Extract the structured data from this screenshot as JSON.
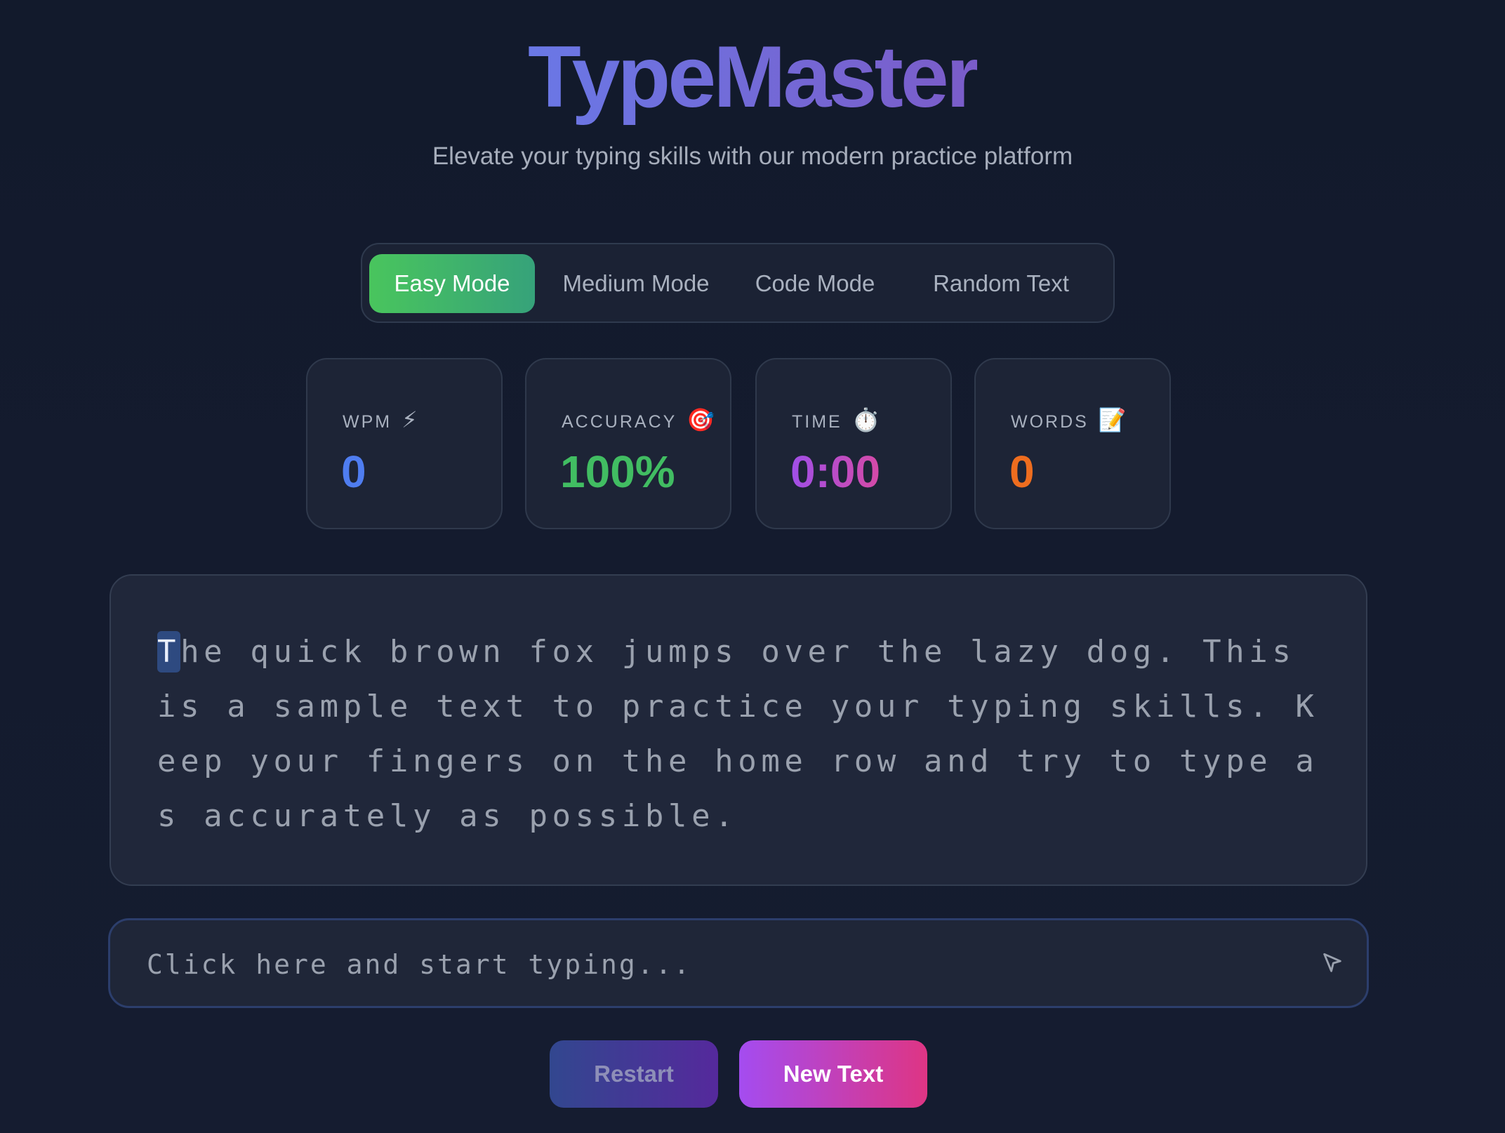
{
  "app": {
    "title": "TypeMaster",
    "subtitle": "Elevate your typing skills with our modern practice platform"
  },
  "modes": [
    {
      "label": "Easy Mode",
      "active": true
    },
    {
      "label": "Medium Mode",
      "active": false
    },
    {
      "label": "Code Mode",
      "active": false
    },
    {
      "label": "Random Text",
      "active": false
    }
  ],
  "stats": {
    "wpm": {
      "label": "WPM",
      "icon": "⚡",
      "icon_name": "lightning-icon",
      "value": "0",
      "color": "#4f7df0"
    },
    "accuracy": {
      "label": "ACCURACY",
      "icon": "🎯",
      "icon_name": "target-icon",
      "value": "100%",
      "color": "#41bd62"
    },
    "time": {
      "label": "TIME",
      "icon": "⏱️",
      "icon_name": "stopwatch-icon",
      "value": "0:00",
      "color": "#a04fe8"
    },
    "words": {
      "label": "WORDS",
      "icon": "📝",
      "icon_name": "memo-icon",
      "value": "0",
      "color": "#ee6d1f"
    }
  },
  "passage": {
    "current_char": "T",
    "remaining_text": "he quick brown fox jumps over the lazy dog. This is a sample text to practice your typing skills. Keep your fingers on the home row and try to type as accurately as possible."
  },
  "input": {
    "value": "",
    "placeholder": "Click here and start typing...",
    "icon_name": "send-arrow-icon"
  },
  "buttons": {
    "restart_label": "Restart",
    "new_text_label": "New Text"
  },
  "colors": {
    "background": "#131a2c",
    "accent_green": "#49c55d",
    "accent_purple": "#a44cf0",
    "accent_pink": "#de3584"
  }
}
